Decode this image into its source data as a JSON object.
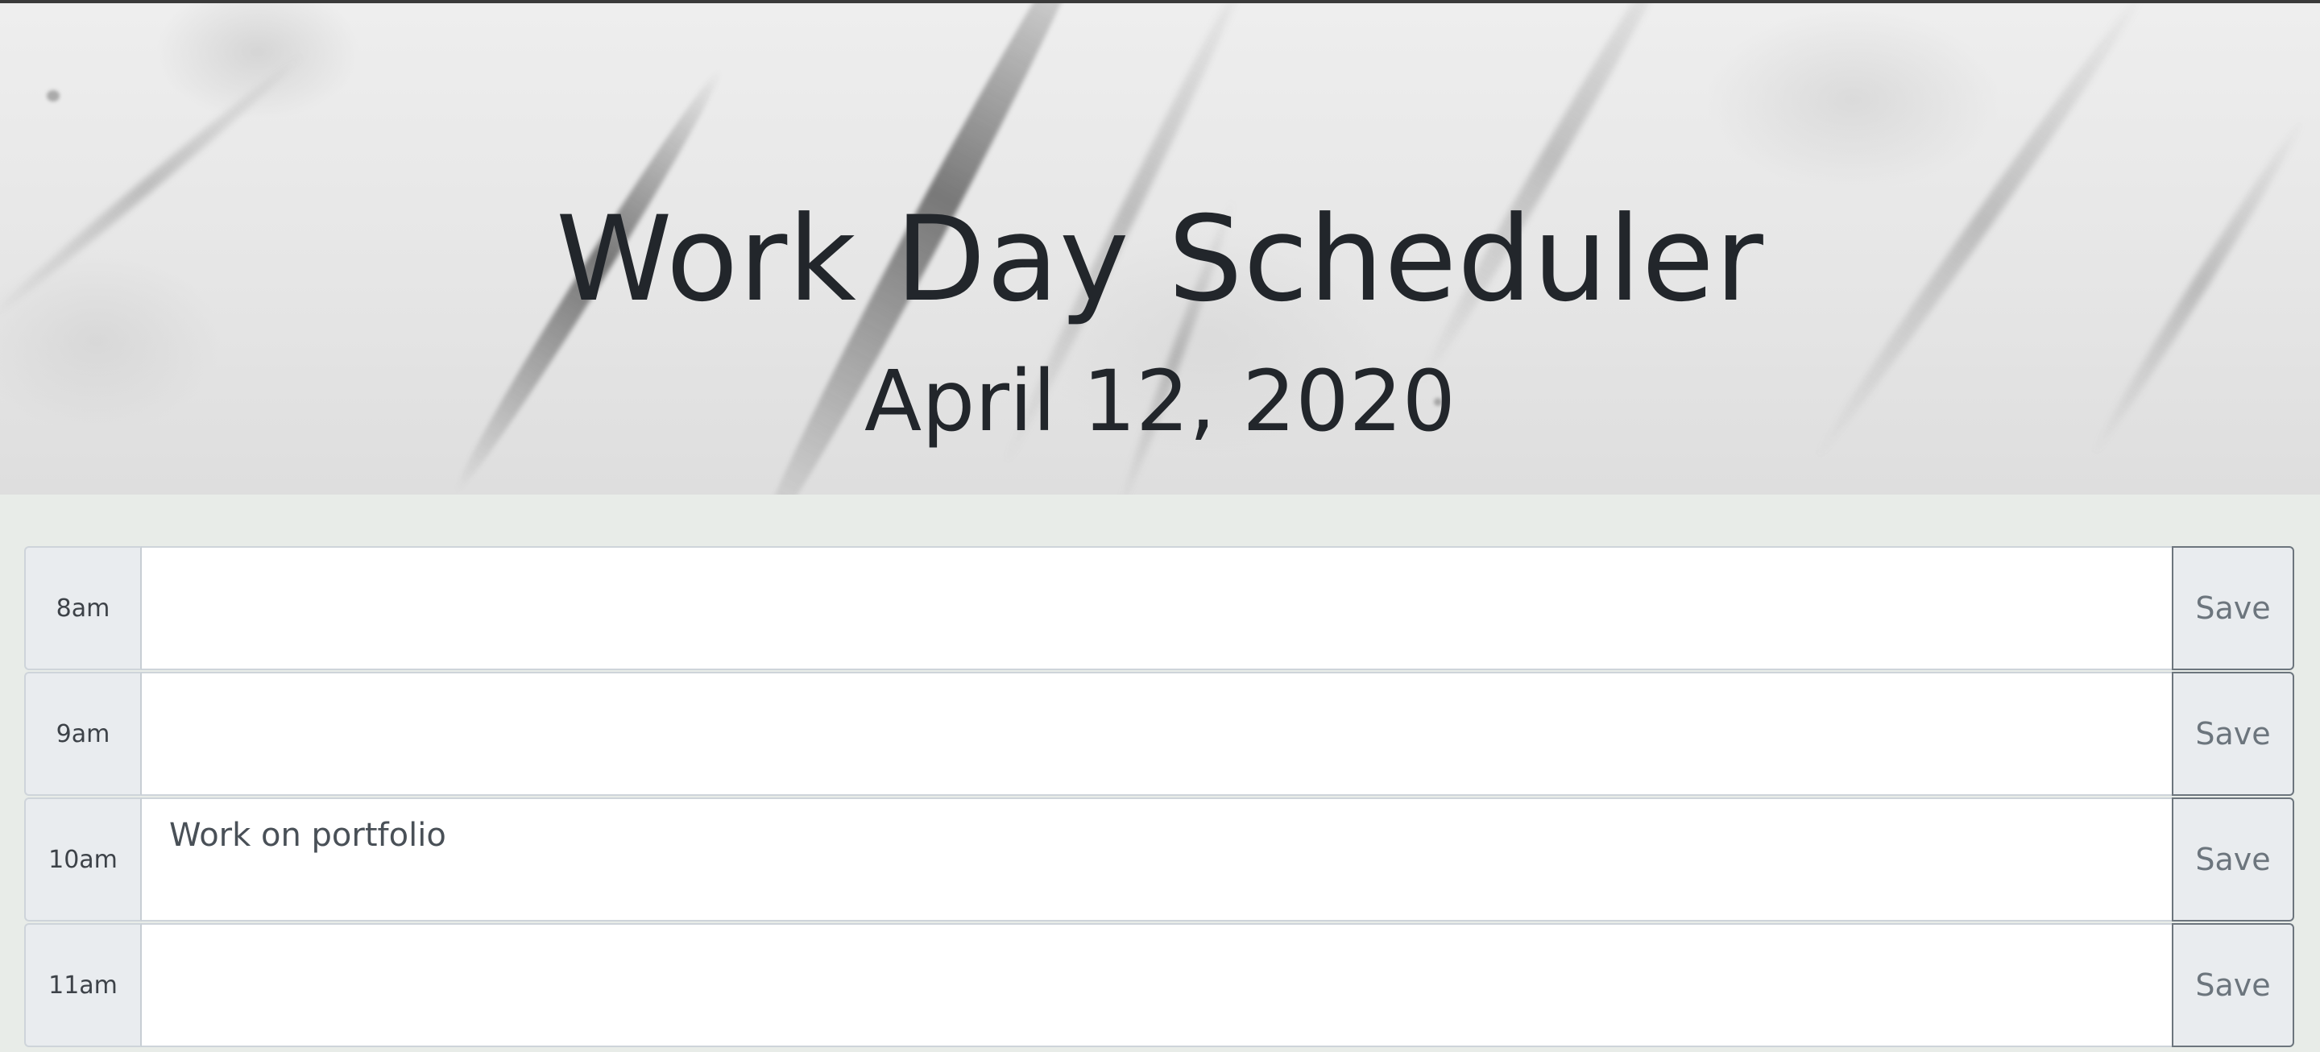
{
  "header": {
    "title": "Work Day Scheduler",
    "current_day": "April 12, 2020"
  },
  "schedule": {
    "save_label": "Save",
    "rows": [
      {
        "hour": "8am",
        "description": ""
      },
      {
        "hour": "9am",
        "description": ""
      },
      {
        "hour": "10am",
        "description": "Work on portfolio"
      },
      {
        "hour": "11am",
        "description": ""
      }
    ]
  },
  "colors": {
    "page_background": "#e8ece8",
    "hour_cell": "#e9ecef",
    "text_area": "#ffffff",
    "save_border": "#6c757d",
    "title_text": "#22262b"
  }
}
